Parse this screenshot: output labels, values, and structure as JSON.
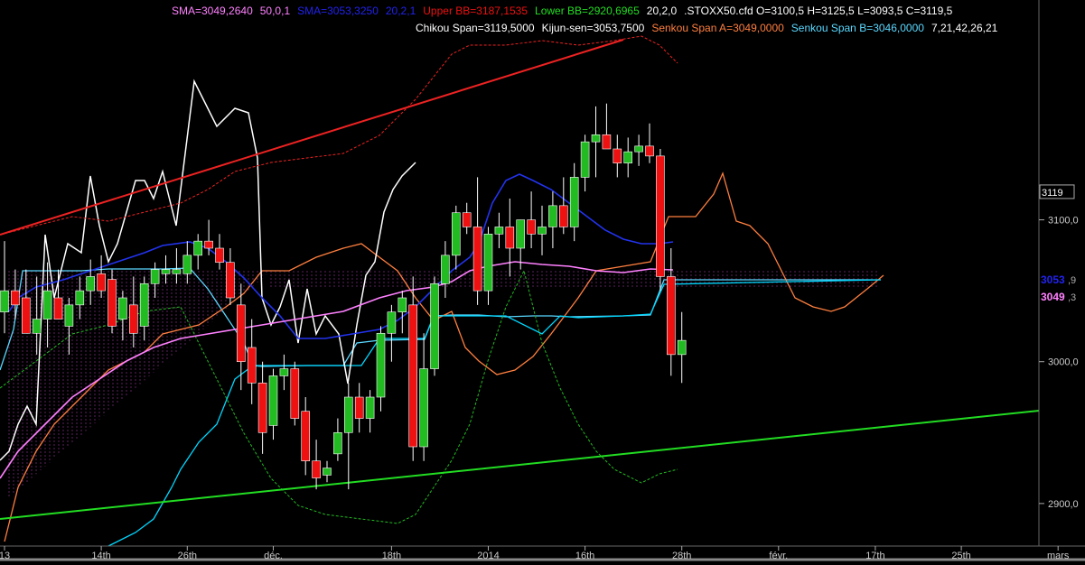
{
  "legend": {
    "line1": [
      {
        "text": "SMA=3049,2640",
        "color": "#ff80ff"
      },
      {
        "text": "50,0,1",
        "color": "#ff80ff"
      },
      {
        "text": "SMA=3053,3250",
        "color": "#2222ee"
      },
      {
        "text": "20,2,1",
        "color": "#2222ee"
      },
      {
        "text": "Upper BB=3187,1535",
        "color": "#ee1111"
      },
      {
        "text": "Lower BB=2920,6965",
        "color": "#22dd22"
      },
      {
        "text": "20,2,0",
        "color": "#ffffff"
      },
      {
        "text": ".STOXX50.cfd O=3100,5 H=3125,5 L=3093,5 C=3119,5",
        "color": "#ffffff"
      }
    ],
    "line2": [
      {
        "text": "Chikou Span=3119,5000",
        "color": "#ffffff"
      },
      {
        "text": "Kijun-sen=3053,7500",
        "color": "#ffffff"
      },
      {
        "text": "Senkou Span A=3049,0000",
        "color": "#ff7f3f"
      },
      {
        "text": "Senkou Span B=3046,0000",
        "color": "#5ad8ff"
      },
      {
        "text": "7,21,42,26,21",
        "color": "#ffffff"
      }
    ]
  },
  "chart_data": {
    "type": "candlestick",
    "instrument": ".STOXX50.cfd",
    "ylim": [
      2870,
      3255
    ],
    "y_ticks": [
      {
        "value": 2900,
        "label": "2900,0"
      },
      {
        "value": 3000,
        "label": "3000,0"
      },
      {
        "value": 3100,
        "label": "3100,0"
      }
    ],
    "x_labels": [
      {
        "label": "13",
        "index": 0
      },
      {
        "label": "14th",
        "index": 9
      },
      {
        "label": "26th",
        "index": 17
      },
      {
        "label": "déc.",
        "index": 25
      },
      {
        "label": "18th",
        "index": 36
      },
      {
        "label": "2014",
        "index": 45
      },
      {
        "label": "16th",
        "index": 54
      },
      {
        "label": "28th",
        "index": 63
      },
      {
        "label": "févr.",
        "index": 72
      },
      {
        "label": "17th",
        "index": 81
      },
      {
        "label": "25th",
        "index": 89
      },
      {
        "label": "mars",
        "index": 98
      }
    ],
    "last_price": {
      "value": 3119.5,
      "label": "3119",
      "color": "#ffffff"
    },
    "price_tags": [
      {
        "value": 3053.9,
        "label": "3053",
        "suffix": ",9",
        "color": "#2222ee"
      },
      {
        "value": 3049.3,
        "label": "3049",
        "suffix": ",3",
        "color": "#ff80ff"
      }
    ],
    "colors": {
      "up": "#22bb22",
      "down": "#ee1111"
    },
    "candles": [
      {
        "o": 3035,
        "h": 3085,
        "l": 3020,
        "c": 3050
      },
      {
        "o": 3050,
        "h": 3065,
        "l": 3030,
        "c": 3040
      },
      {
        "o": 3045,
        "h": 3065,
        "l": 3025,
        "c": 3020
      },
      {
        "o": 3020,
        "h": 3060,
        "l": 3005,
        "c": 3030
      },
      {
        "o": 3030,
        "h": 3070,
        "l": 3010,
        "c": 3050
      },
      {
        "o": 3045,
        "h": 3065,
        "l": 3030,
        "c": 3030
      },
      {
        "o": 3025,
        "h": 3045,
        "l": 3005,
        "c": 3040
      },
      {
        "o": 3040,
        "h": 3060,
        "l": 3030,
        "c": 3050
      },
      {
        "o": 3050,
        "h": 3072,
        "l": 3040,
        "c": 3060
      },
      {
        "o": 3062,
        "h": 3075,
        "l": 3045,
        "c": 3050
      },
      {
        "o": 3058,
        "h": 3065,
        "l": 3020,
        "c": 3025
      },
      {
        "o": 3030,
        "h": 3050,
        "l": 3015,
        "c": 3045
      },
      {
        "o": 3040,
        "h": 3060,
        "l": 3010,
        "c": 3020
      },
      {
        "o": 3025,
        "h": 3060,
        "l": 3015,
        "c": 3055
      },
      {
        "o": 3055,
        "h": 3070,
        "l": 3045,
        "c": 3065
      },
      {
        "o": 3062,
        "h": 3075,
        "l": 3055,
        "c": 3065
      },
      {
        "o": 3062,
        "h": 3080,
        "l": 3055,
        "c": 3065
      },
      {
        "o": 3062,
        "h": 3085,
        "l": 3055,
        "c": 3075
      },
      {
        "o": 3075,
        "h": 3090,
        "l": 3065,
        "c": 3085
      },
      {
        "o": 3085,
        "h": 3100,
        "l": 3075,
        "c": 3080
      },
      {
        "o": 3080,
        "h": 3090,
        "l": 3065,
        "c": 3070
      },
      {
        "o": 3070,
        "h": 3080,
        "l": 3040,
        "c": 3045
      },
      {
        "o": 3040,
        "h": 3055,
        "l": 2980,
        "c": 3000
      },
      {
        "o": 3010,
        "h": 3030,
        "l": 2970,
        "c": 2985
      },
      {
        "o": 2985,
        "h": 3000,
        "l": 2935,
        "c": 2950
      },
      {
        "o": 2955,
        "h": 2995,
        "l": 2945,
        "c": 2990
      },
      {
        "o": 2990,
        "h": 3005,
        "l": 2980,
        "c": 2995
      },
      {
        "o": 2995,
        "h": 3000,
        "l": 2955,
        "c": 2960
      },
      {
        "o": 2965,
        "h": 2975,
        "l": 2920,
        "c": 2930
      },
      {
        "o": 2930,
        "h": 2945,
        "l": 2910,
        "c": 2918
      },
      {
        "o": 2920,
        "h": 2930,
        "l": 2915,
        "c": 2925
      },
      {
        "o": 2935,
        "h": 2960,
        "l": 2930,
        "c": 2950
      },
      {
        "o": 2950,
        "h": 2985,
        "l": 2910,
        "c": 2975
      },
      {
        "o": 2975,
        "h": 2985,
        "l": 2950,
        "c": 2960
      },
      {
        "o": 2960,
        "h": 2980,
        "l": 2950,
        "c": 2975
      },
      {
        "o": 2975,
        "h": 3025,
        "l": 2965,
        "c": 3020
      },
      {
        "o": 3020,
        "h": 3040,
        "l": 3000,
        "c": 3035
      },
      {
        "o": 3035,
        "h": 3050,
        "l": 3020,
        "c": 3045
      },
      {
        "o": 3040,
        "h": 3060,
        "l": 2930,
        "c": 2940
      },
      {
        "o": 2940,
        "h": 3020,
        "l": 2930,
        "c": 2995
      },
      {
        "o": 2995,
        "h": 3060,
        "l": 2990,
        "c": 3055
      },
      {
        "o": 3055,
        "h": 3085,
        "l": 3045,
        "c": 3075
      },
      {
        "o": 3075,
        "h": 3110,
        "l": 3065,
        "c": 3105
      },
      {
        "o": 3105,
        "h": 3112,
        "l": 3090,
        "c": 3095
      },
      {
        "o": 3095,
        "h": 3130,
        "l": 3040,
        "c": 3050
      },
      {
        "o": 3050,
        "h": 3095,
        "l": 3040,
        "c": 3090
      },
      {
        "o": 3090,
        "h": 3105,
        "l": 3080,
        "c": 3095
      },
      {
        "o": 3095,
        "h": 3115,
        "l": 3060,
        "c": 3080
      },
      {
        "o": 3080,
        "h": 3100,
        "l": 3065,
        "c": 3100
      },
      {
        "o": 3100,
        "h": 3120,
        "l": 3080,
        "c": 3090
      },
      {
        "o": 3090,
        "h": 3110,
        "l": 3075,
        "c": 3095
      },
      {
        "o": 3095,
        "h": 3120,
        "l": 3080,
        "c": 3110
      },
      {
        "o": 3110,
        "h": 3130,
        "l": 3090,
        "c": 3095
      },
      {
        "o": 3095,
        "h": 3140,
        "l": 3085,
        "c": 3130
      },
      {
        "o": 3130,
        "h": 3160,
        "l": 3120,
        "c": 3155
      },
      {
        "o": 3155,
        "h": 3180,
        "l": 3130,
        "c": 3160
      },
      {
        "o": 3160,
        "h": 3182,
        "l": 3150,
        "c": 3150
      },
      {
        "o": 3150,
        "h": 3160,
        "l": 3130,
        "c": 3140
      },
      {
        "o": 3140,
        "h": 3158,
        "l": 3130,
        "c": 3148
      },
      {
        "o": 3148,
        "h": 3160,
        "l": 3138,
        "c": 3152
      },
      {
        "o": 3152,
        "h": 3168,
        "l": 3140,
        "c": 3145
      },
      {
        "o": 3145,
        "h": 3150,
        "l": 3050,
        "c": 3060
      },
      {
        "o": 3060,
        "h": 3080,
        "l": 2990,
        "c": 3005
      },
      {
        "o": 3005,
        "h": 3035,
        "l": 2985,
        "c": 3015
      }
    ]
  }
}
